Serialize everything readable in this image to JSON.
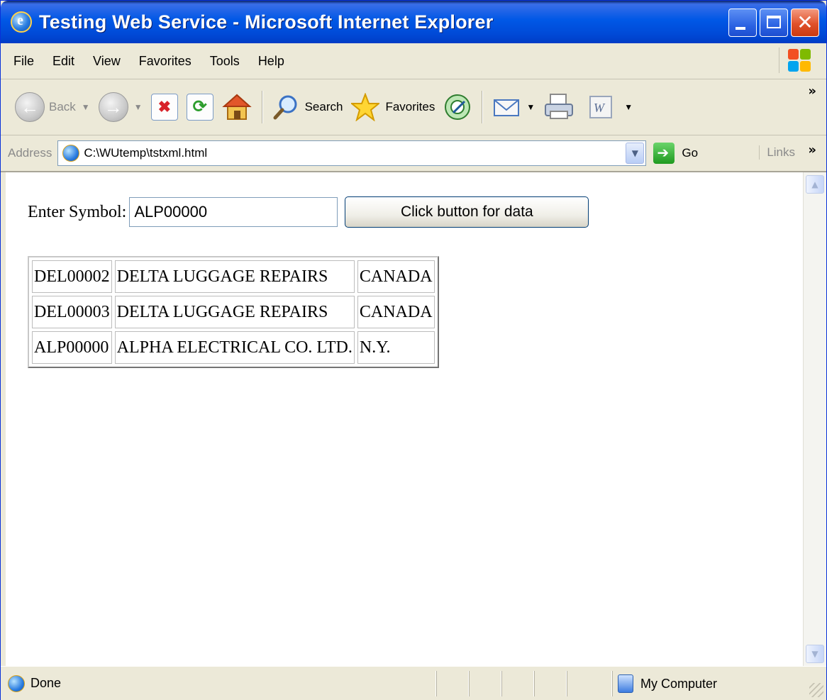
{
  "window": {
    "title": "Testing Web Service - Microsoft Internet Explorer"
  },
  "menu": {
    "items": [
      {
        "label": "File"
      },
      {
        "label": "Edit"
      },
      {
        "label": "View"
      },
      {
        "label": "Favorites"
      },
      {
        "label": "Tools"
      },
      {
        "label": "Help"
      }
    ]
  },
  "toolbar": {
    "back_label": "Back",
    "search_label": "Search",
    "favorites_label": "Favorites"
  },
  "address": {
    "label": "Address",
    "url": "C:\\WUtemp\\tstxml.html",
    "go_label": "Go",
    "links_label": "Links"
  },
  "page": {
    "symbol_label": "Enter Symbol:",
    "symbol_value": "ALP00000",
    "button_label": "Click button for data",
    "rows": [
      [
        "DEL00002",
        "DELTA LUGGAGE REPAIRS",
        "CANADA"
      ],
      [
        "DEL00003",
        "DELTA LUGGAGE REPAIRS",
        "CANADA"
      ],
      [
        "ALP00000",
        "ALPHA ELECTRICAL CO. LTD.",
        "N.Y."
      ]
    ]
  },
  "status": {
    "text": "Done",
    "zone": "My Computer"
  },
  "colors": {
    "titlebar": "#0058e6",
    "chrome": "#ece9d8",
    "close_button": "#e0512a"
  }
}
